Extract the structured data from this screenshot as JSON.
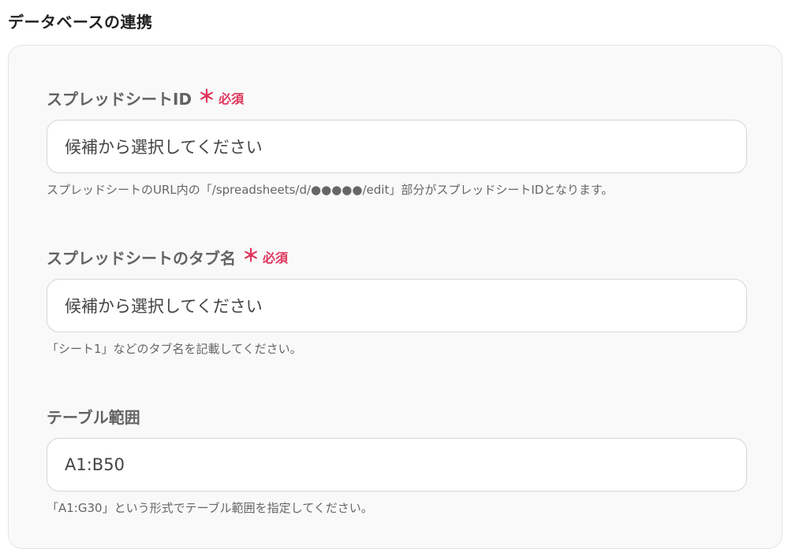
{
  "section": {
    "title": "データベースの連携"
  },
  "fields": [
    {
      "label": "スプレッドシートID",
      "required_mark": "＊",
      "required_text": "必須",
      "value": "候補から選択してください",
      "help": "スプレッドシートのURL内の「/spreadsheets/d/●●●●●/edit」部分がスプレッドシートIDとなります。"
    },
    {
      "label": "スプレッドシートのタブ名",
      "required_mark": "＊",
      "required_text": "必須",
      "value": "候補から選択してください",
      "help": "「シート1」などのタブ名を記載してください。"
    },
    {
      "label": "テーブル範囲",
      "value": "A1:B50",
      "help": "「A1:G30」という形式でテーブル範囲を指定してください。"
    }
  ],
  "colors": {
    "required": "#e0345b",
    "label": "#636363",
    "panel_bg": "#f9f9f9"
  }
}
